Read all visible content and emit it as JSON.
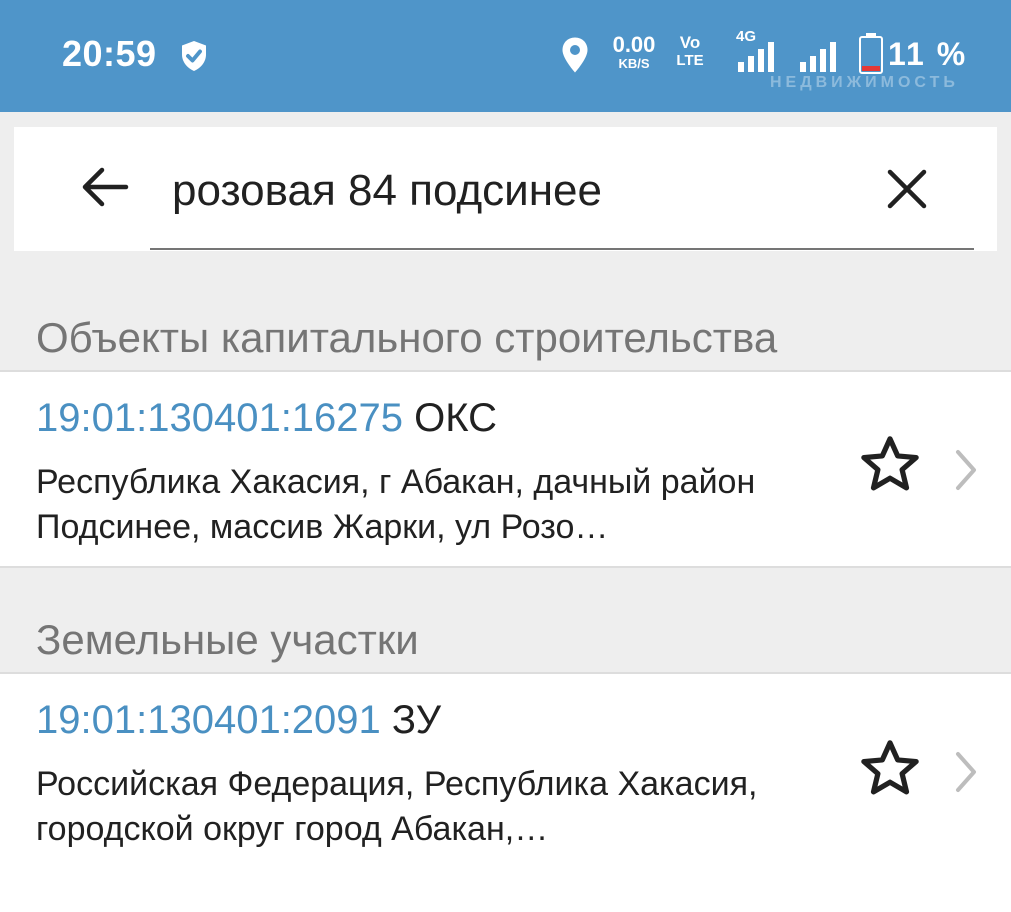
{
  "status_bar": {
    "time": "20:59",
    "net_speed_value": "0.00",
    "net_speed_unit": "KB/S",
    "volte_top": "Vo",
    "volte_bottom": "LTE",
    "network_type": "4G",
    "battery_percent": "11 %",
    "watermark": "НЕДВИЖИМОСТЬ",
    "icons": [
      "shield-check-icon",
      "location-icon",
      "signal-icon",
      "signal-icon",
      "battery-low-icon"
    ]
  },
  "search": {
    "query": "розовая 84 подсинее",
    "icons": [
      "back-arrow-icon",
      "clear-icon"
    ]
  },
  "sections": [
    {
      "header": "Объекты капитального строительства",
      "results": [
        {
          "cadastral_number": "19:01:130401:16275",
          "type": "ОКС",
          "address": "Республика Хакасия, г Абакан, дачный район Подсинее, массив Жарки, ул Розо…"
        }
      ]
    },
    {
      "header": "Земельные участки",
      "results": [
        {
          "cadastral_number": "19:01:130401:2091",
          "type": "ЗУ",
          "address": "Российская Федерация, Республика Хакасия, городской округ город Абакан,…"
        }
      ]
    }
  ],
  "colors": {
    "status_bar": "#4f95c9",
    "cadastral_link": "#4a90c2",
    "background": "#eeeeee",
    "section_header": "#757575",
    "battery_low": "#e53935"
  }
}
